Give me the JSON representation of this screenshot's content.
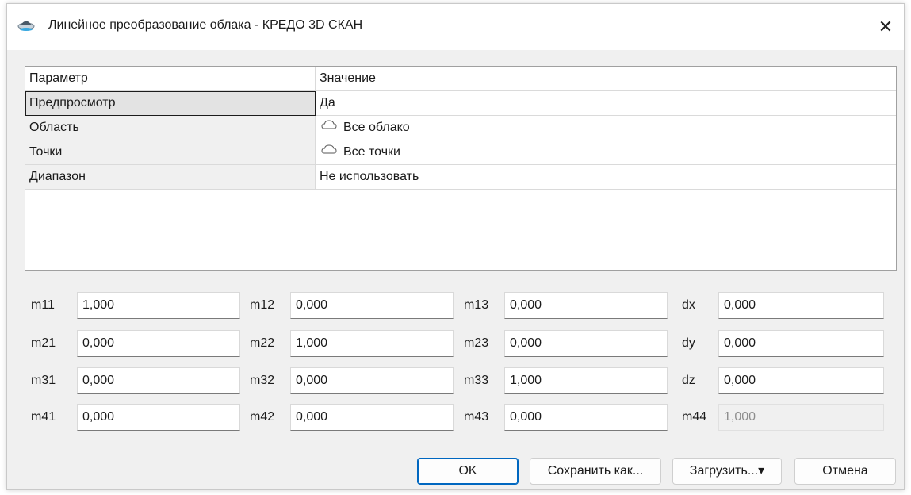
{
  "window": {
    "title": "Линейное преобразование облака - КРЕДО 3D СКАН",
    "close_glyph": "✕",
    "icon": "app-icon"
  },
  "grid": {
    "columns": [
      "Параметр",
      "Значение"
    ],
    "rows": [
      {
        "name": "Предпросмотр",
        "value": "Да",
        "icon": ""
      },
      {
        "name": "Область",
        "value": "Все облако",
        "icon": "cloud-icon"
      },
      {
        "name": "Точки",
        "value": "Все точки",
        "icon": "cloud-icon"
      },
      {
        "name": "Диапазон",
        "value": "Не использовать",
        "icon": ""
      }
    ]
  },
  "matrix": {
    "labels": {
      "m11": "m11",
      "m12": "m12",
      "m13": "m13",
      "dx": "dx",
      "m21": "m21",
      "m22": "m22",
      "m23": "m23",
      "dy": "dy",
      "m31": "m31",
      "m32": "m32",
      "m33": "m33",
      "dz": "dz",
      "m41": "m41",
      "m42": "m42",
      "m43": "m43",
      "m44": "m44"
    },
    "values": {
      "m11": "1,000",
      "m12": "0,000",
      "m13": "0,000",
      "dx": "0,000",
      "m21": "0,000",
      "m22": "1,000",
      "m23": "0,000",
      "dy": "0,000",
      "m31": "0,000",
      "m32": "0,000",
      "m33": "1,000",
      "dz": "0,000",
      "m41": "0,000",
      "m42": "0,000",
      "m43": "0,000",
      "m44": "1,000"
    }
  },
  "buttons": {
    "ok": "OK",
    "save_as": "Сохранить как...",
    "load": "Загрузить...",
    "load_arrow": "▾",
    "cancel": "Отмена"
  },
  "colors": {
    "accent": "#0067c0",
    "window_bg": "#f0f0f0"
  }
}
